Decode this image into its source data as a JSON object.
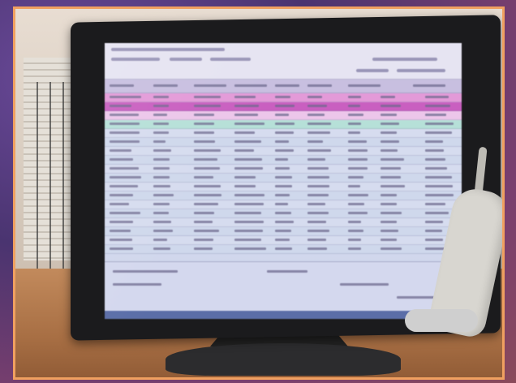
{
  "scene": {
    "subject": "computer-monitor-with-barcode-scanner",
    "frame_color": "#f0a060",
    "screen": {
      "rows": [
        "pink",
        "magenta",
        "lightpink",
        "sel",
        "alt",
        "plain",
        "alt",
        "plain",
        "alt",
        "plain",
        "alt",
        "plain",
        "alt",
        "plain",
        "alt",
        "plain",
        "alt",
        "plain"
      ]
    }
  }
}
